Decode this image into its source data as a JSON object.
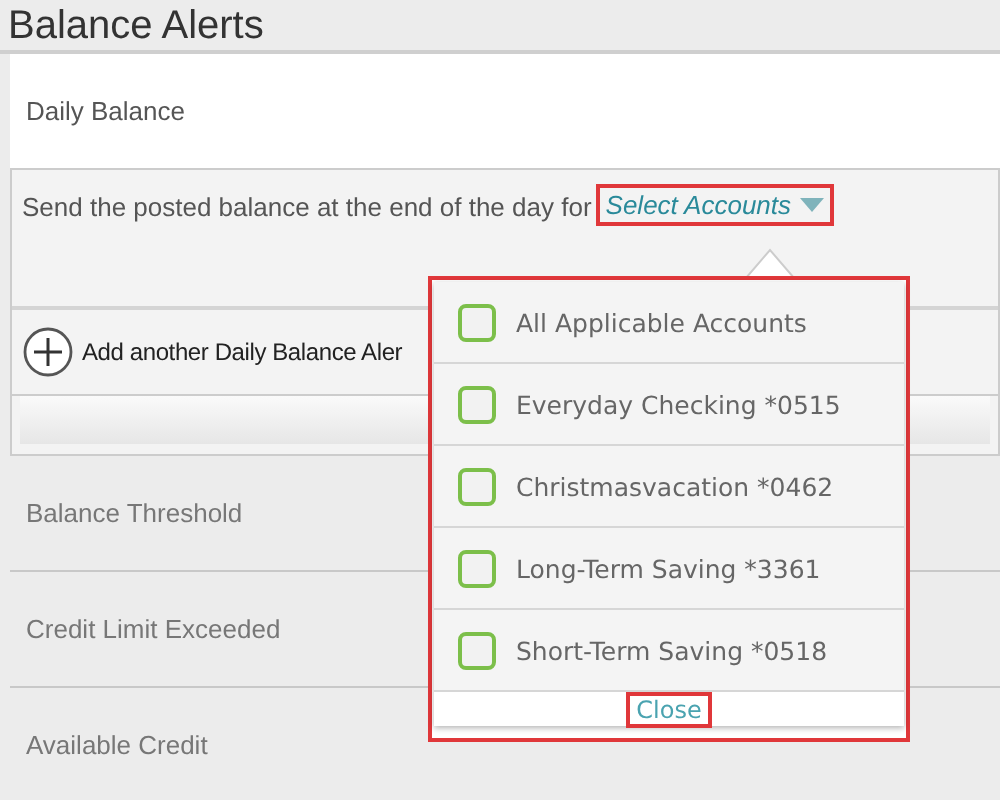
{
  "page_title": "Balance Alerts",
  "daily_section": {
    "title": "Daily Balance",
    "sentence": "Send the posted balance at the end of the day for",
    "select": {
      "label": "Select Accounts",
      "highlighted": true
    },
    "add_link": "Add another Daily Balance Aler"
  },
  "sections": [
    {
      "title": "Balance Threshold"
    },
    {
      "title": "Credit Limit Exceeded"
    },
    {
      "title": "Available Credit"
    }
  ],
  "accounts_dropdown": {
    "highlighted": true,
    "options": [
      {
        "label": "All Applicable Accounts",
        "checked": false
      },
      {
        "label": "Everyday Checking *0515",
        "checked": false
      },
      {
        "label": "Christmasvacation *0462",
        "checked": false
      },
      {
        "label": "Long-Term Saving *3361",
        "checked": false
      },
      {
        "label": "Short-Term Saving *0518",
        "checked": false
      }
    ],
    "close": {
      "label": "Close",
      "highlighted": true
    }
  }
}
